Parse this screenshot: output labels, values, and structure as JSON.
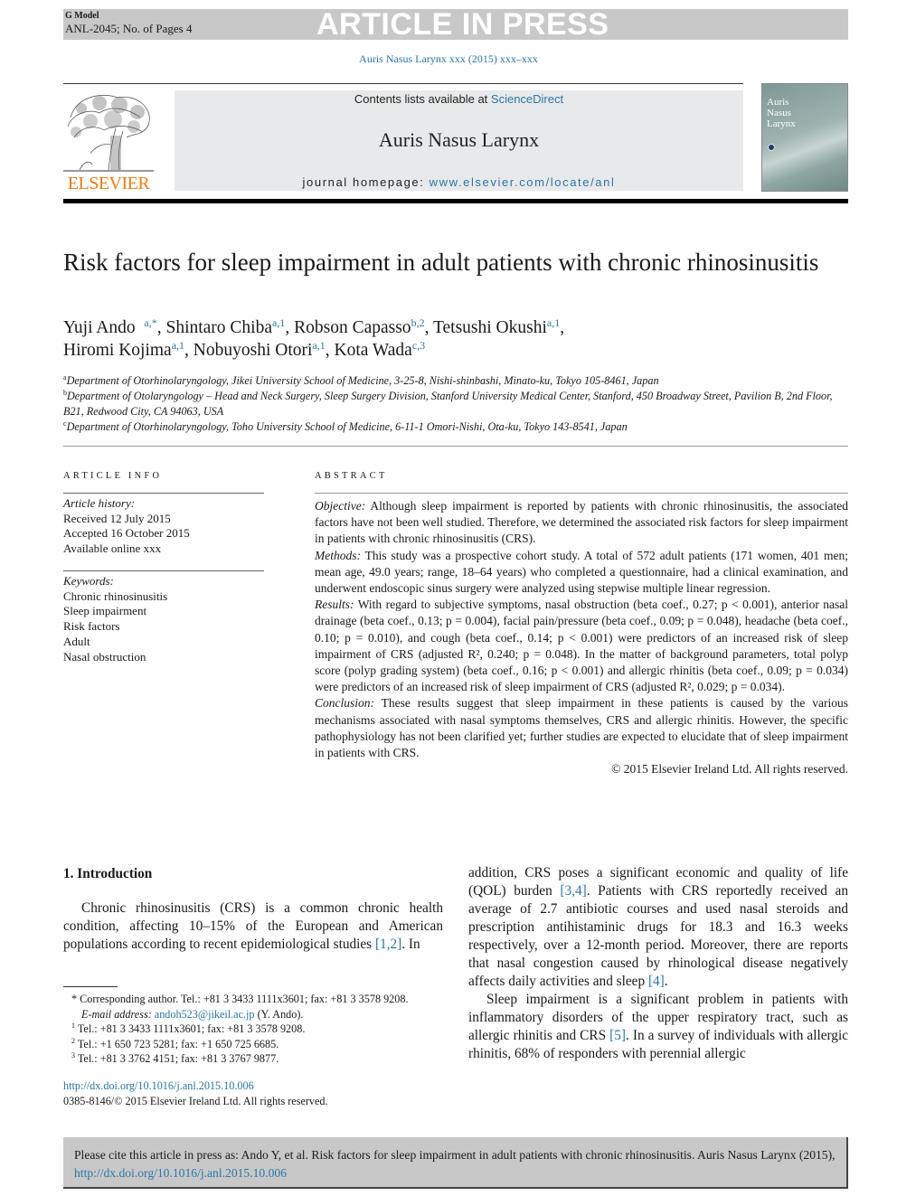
{
  "banner": {
    "g_model": "G Model",
    "manuscript_id": "ANL-2045; No. of Pages 4",
    "status": "ARTICLE IN PRESS"
  },
  "journal_reference": "Auris Nasus Larynx xxx (2015) xxx–xxx",
  "masthead": {
    "publisher": "ELSEVIER",
    "contents_prefix": "Contents lists available at ",
    "contents_link": "ScienceDirect",
    "journal_name": "Auris Nasus Larynx",
    "homepage_prefix": "journal homepage: ",
    "homepage_link": "www.elsevier.com/locate/anl",
    "cover_title": [
      "Auris",
      "Nasus",
      "Larynx"
    ]
  },
  "article": {
    "title": "Risk factors for sleep impairment in adult patients with chronic rhinosinusitis",
    "authors": [
      {
        "name": "Yuji Ando",
        "marks": "a,*",
        "sep": ", "
      },
      {
        "name": "Shintaro Chiba",
        "marks": "a,1",
        "sep": ", "
      },
      {
        "name": "Robson Capasso",
        "marks": "b,2",
        "sep": ", "
      },
      {
        "name": "Tetsushi Okushi",
        "marks": "a,1",
        "sep": ","
      },
      {
        "name": "Hiromi Kojima",
        "marks": "a,1",
        "sep": ", "
      },
      {
        "name": "Nobuyoshi Otori",
        "marks": "a,1",
        "sep": ", "
      },
      {
        "name": "Kota Wada",
        "marks": "c,3",
        "sep": ""
      }
    ],
    "affiliations": [
      {
        "mark": "a",
        "text": "Department of Otorhinolaryngology, Jikei University School of Medicine, 3-25-8, Nishi-shinbashi, Minato-ku, Tokyo 105-8461, Japan"
      },
      {
        "mark": "b",
        "text": "Department of Otolaryngology – Head and Neck Surgery, Sleep Surgery Division, Stanford University Medical Center, Stanford, 450 Broadway Street, Pavilion B, 2nd Floor, B21, Redwood City, CA 94063, USA"
      },
      {
        "mark": "c",
        "text": "Department of Otorhinolaryngology, Toho University School of Medicine, 6-11-1 Omori-Nishi, Ota-ku, Tokyo 143-8541, Japan"
      }
    ]
  },
  "article_info": {
    "heading": "ARTICLE INFO",
    "history_label": "Article history:",
    "received": "Received 12 July 2015",
    "accepted": "Accepted 16 October 2015",
    "online": "Available online xxx",
    "keywords_label": "Keywords:",
    "keywords": [
      "Chronic rhinosinusitis",
      "Sleep impairment",
      "Risk factors",
      "Adult",
      "Nasal obstruction"
    ]
  },
  "abstract": {
    "heading": "ABSTRACT",
    "objective_label": "Objective:",
    "objective": " Although sleep impairment is reported by patients with chronic rhinosinusitis, the associated factors have not been well studied. Therefore, we determined the associated risk factors for sleep impairment in patients with chronic rhinosinusitis (CRS).",
    "methods_label": "Methods:",
    "methods": " This study was a prospective cohort study. A total of 572 adult patients (171 women, 401 men; mean age, 49.0 years; range, 18–64 years) who completed a questionnaire, had a clinical examination, and underwent endoscopic sinus surgery were analyzed using stepwise multiple linear regression.",
    "results_label": "Results:",
    "results": " With regard to subjective symptoms, nasal obstruction (beta coef., 0.27; p < 0.001), anterior nasal drainage (beta coef., 0.13; p = 0.004), facial pain/pressure (beta coef., 0.09; p = 0.048), headache (beta coef., 0.10; p = 0.010), and cough (beta coef., 0.14; p < 0.001) were predictors of an increased risk of sleep impairment of CRS (adjusted R², 0.240; p = 0.048). In the matter of background parameters, total polyp score (polyp grading system) (beta coef., 0.16; p < 0.001) and allergic rhinitis (beta coef., 0.09; p = 0.034) were predictors of an increased risk of sleep impairment of CRS (adjusted R², 0.029; p = 0.034).",
    "conclusion_label": "Conclusion:",
    "conclusion": " These results suggest that sleep impairment in these patients is caused by the various mechanisms associated with nasal symptoms themselves, CRS and allergic rhinitis. However, the specific pathophysiology has not been clarified yet; further studies are expected to elucidate that of sleep impairment in patients with CRS.",
    "copyright": "© 2015 Elsevier Ireland Ltd. All rights reserved."
  },
  "body": {
    "section_heading": "1.  Introduction",
    "p1_text": "Chronic rhinosinusitis (CRS) is a common chronic health condition, affecting 10–15% of the European and American populations according to recent epidemiological studies ",
    "p1_ref": "[1,2]",
    "p1_end": ". In",
    "p2_a": "addition, CRS poses a significant economic and quality of life (QOL) burden ",
    "p2_ref1": "[3,4]",
    "p2_b": ". Patients with CRS reportedly received an average of 2.7 antibiotic courses and used nasal steroids and prescription antihistaminic drugs for 18.3 and 16.3 weeks respectively, over a 12-month period. Moreover, there are reports that nasal congestion caused by rhinological disease negatively affects daily activities and sleep ",
    "p2_ref2": "[4]",
    "p2_c": ".",
    "p3_a": "Sleep impairment is a significant problem in patients with inflammatory disorders of the upper respiratory tract, such as allergic rhinitis and CRS ",
    "p3_ref": "[5]",
    "p3_b": ". In a survey of individuals with allergic rhinitis, 68% of responders with perennial allergic"
  },
  "footnotes": {
    "corr_mark": "*",
    "corr_text": " Corresponding author. Tel.: +81 3 3433 1111x3601; fax: +81 3 3578 9208.",
    "email_label": "E-mail address:",
    "email": "andoh523@jikeil.ac.jp",
    "email_suffix": " (Y. Ando).",
    "notes": [
      {
        "mark": "1",
        "text": " Tel.: +81 3 3433 1111x3601; fax: +81 3 3578 9208."
      },
      {
        "mark": "2",
        "text": " Tel.: +1 650 723 5281; fax: +1 650 725 6685."
      },
      {
        "mark": "3",
        "text": " Tel.: +81 3 3762 4151; fax: +81 3 3767 9877."
      }
    ],
    "doi_link": "http://dx.doi.org/10.1016/j.anl.2015.10.006",
    "issn_line": "0385-8146/© 2015 Elsevier Ireland Ltd. All rights reserved."
  },
  "citation_box": {
    "text": "Please cite this article in press as: Ando Y, et al. Risk factors for sleep impairment in adult patients with chronic rhinosinusitis. Auris Nasus Larynx (2015), ",
    "link": "http://dx.doi.org/10.1016/j.anl.2015.10.006"
  }
}
